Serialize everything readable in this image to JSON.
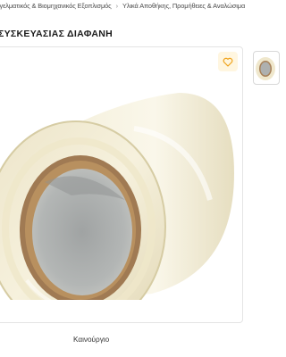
{
  "breadcrumb": {
    "items": [
      "Επαγγελματικός & Βιομηχανικός Εξοπλισμός",
      "Υλικά Αποθήκης, Προμήθειες & Αναλώσιμα"
    ],
    "separator": "›"
  },
  "product": {
    "title": "ΣΥΣΚΕΥΑΣΙΑΣ ΔΙΑΦΑΝΗ",
    "condition": "Καινούργιο",
    "image_icon": "packing-tape-roll",
    "wishlist_icon": "heart-icon"
  },
  "colors": {
    "accent": "#f0a31b",
    "wish_bg": "#fff6e0"
  }
}
